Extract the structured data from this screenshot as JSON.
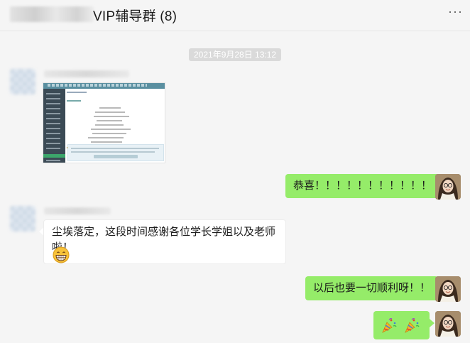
{
  "header": {
    "title": "VIP辅导群 (8)",
    "more_label": "···"
  },
  "chat": {
    "timestamp": "2021年9月28日 13:12",
    "messages": [
      {
        "side": "left",
        "type": "image"
      },
      {
        "side": "right",
        "type": "text",
        "text": "恭喜！！！！！！！！！！！"
      },
      {
        "side": "left",
        "type": "text",
        "text": "尘埃落定，这段时间感谢各位学长学姐以及老师啦！",
        "emoji": "grin-emoji"
      },
      {
        "side": "right",
        "type": "text",
        "text": "以后也要一切顺利呀！！"
      },
      {
        "side": "right",
        "type": "emoji",
        "emoji": [
          "party-popper-emoji",
          "party-popper-emoji"
        ]
      }
    ]
  },
  "colors": {
    "background": "#f5f5f5",
    "bubble_self": "#95ec69",
    "bubble_other": "#ffffff",
    "timestamp_bg": "#dadada"
  }
}
